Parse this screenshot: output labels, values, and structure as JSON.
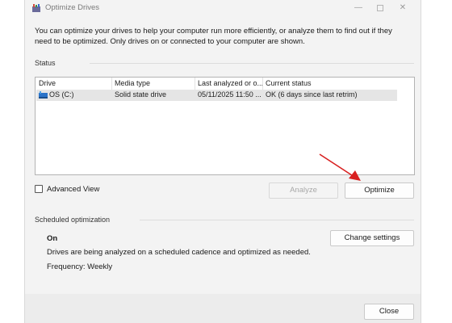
{
  "window": {
    "title": "Optimize Drives",
    "description": "You can optimize your drives to help your computer run more efficiently, or analyze them to find out if they need to be optimized. Only drives on or connected to your computer are shown."
  },
  "status": {
    "section_label": "Status",
    "columns": [
      "Drive",
      "Media type",
      "Last analyzed or o...",
      "Current status"
    ],
    "rows": [
      {
        "drive": "OS (C:)",
        "media_type": "Solid state drive",
        "last_analyzed": "05/11/2025 11:50 ...",
        "current_status": "OK (6 days since last retrim)"
      }
    ]
  },
  "controls": {
    "advanced_view_label": "Advanced View",
    "advanced_view_checked": false,
    "analyze_label": "Analyze",
    "optimize_label": "Optimize"
  },
  "scheduled": {
    "section_label": "Scheduled optimization",
    "state": "On",
    "description": "Drives are being analyzed on a scheduled cadence and optimized as needed.",
    "frequency": "Frequency: Weekly",
    "change_settings_label": "Change settings"
  },
  "footer": {
    "close_label": "Close"
  },
  "colors": {
    "accent_arrow": "#d82020",
    "row_highlight": "#e5e5e5",
    "window_bg": "#f3f3f3"
  },
  "icons": {
    "app": "optimize-drives-icon",
    "drive": "drive-icon"
  }
}
